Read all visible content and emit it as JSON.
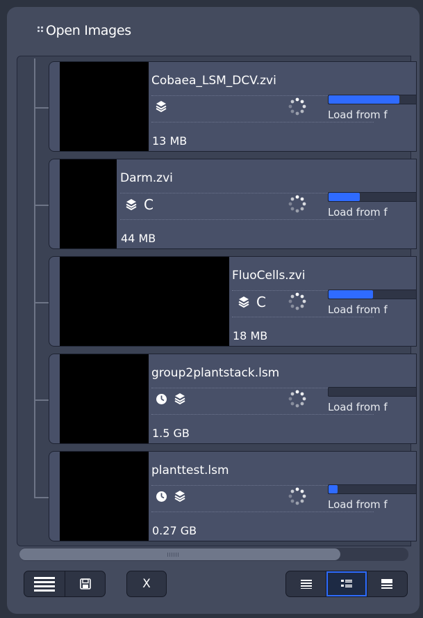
{
  "panel": {
    "title": "Open Images"
  },
  "images": [
    {
      "name": "Cobaea_LSM_DCV.zvi",
      "size": "13 MB",
      "icons": [
        "layers-icon"
      ],
      "channel": "",
      "progress": 0.8,
      "status": "Load from f"
    },
    {
      "name": "Darm.zvi",
      "size": "44 MB",
      "icons": [
        "layers-icon"
      ],
      "channel": "C",
      "progress": 0.35,
      "status": "Load from f"
    },
    {
      "name": "FluoCells.zvi",
      "size": "18 MB",
      "icons": [
        "layers-icon"
      ],
      "channel": "C",
      "progress": 0.5,
      "status": "Load from f"
    },
    {
      "name": "group2plantstack.lsm",
      "size": "1.5 GB",
      "icons": [
        "clock-icon",
        "layers-icon"
      ],
      "channel": "",
      "progress": 0.0,
      "status": "Load from f"
    },
    {
      "name": "planttest.lsm",
      "size": "0.27 GB",
      "icons": [
        "clock-icon",
        "layers-icon"
      ],
      "channel": "",
      "progress": 0.1,
      "status": "Load from f"
    }
  ],
  "toolbar": {
    "close_label": "X",
    "view_modes": [
      "list-view-icon",
      "detail-view-icon",
      "gallery-view-icon"
    ],
    "active_view": "detail-view-icon"
  },
  "colors": {
    "progress_fill": "#2f6bff",
    "panel_bg": "#444b5e",
    "card_bg": "#485068"
  }
}
